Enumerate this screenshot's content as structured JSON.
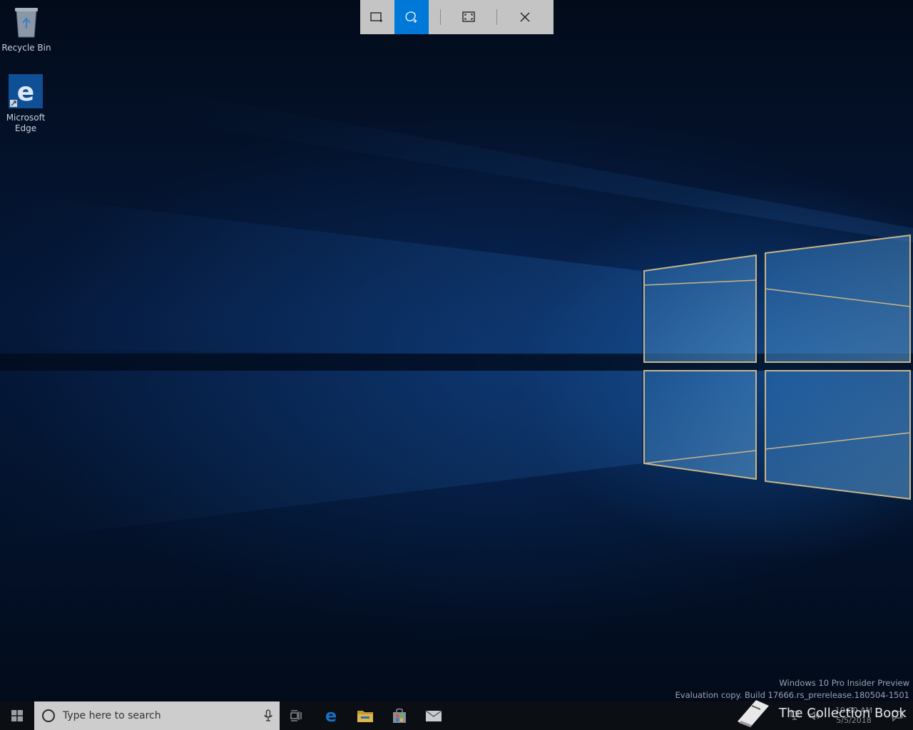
{
  "desktop": {
    "icons": [
      {
        "label": "Recycle Bin"
      },
      {
        "label": "Microsoft Edge"
      }
    ]
  },
  "snip_toolbar": {
    "modes": [
      {
        "icon": "rectangular-snip-icon",
        "selected": false
      },
      {
        "icon": "freeform-snip-icon",
        "selected": true
      },
      {
        "icon": "fullscreen-snip-icon",
        "selected": false
      }
    ],
    "close_icon": "close-icon",
    "selected_color": "#0078d7"
  },
  "watermark": {
    "line1": "Windows 10 Pro Insider Preview",
    "line2": "Evaluation copy. Build 17666.rs_prerelease.180504-1501"
  },
  "taskbar": {
    "search_placeholder": "Type here to search",
    "pinned": [
      "task-view-icon",
      "edge-icon",
      "file-explorer-icon",
      "store-icon",
      "mail-icon"
    ],
    "clock_time": "10:00 AM",
    "clock_date": "5/5/2018"
  },
  "overlay": {
    "brand": "The Collection Book"
  }
}
